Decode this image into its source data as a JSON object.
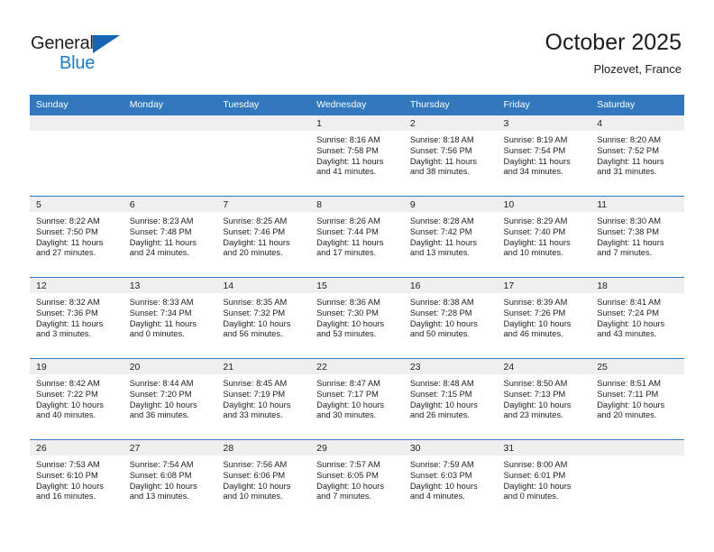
{
  "brand": {
    "name_part1": "General",
    "name_part2": "Blue",
    "triangle_icon": "triangle-icon",
    "colors": {
      "dark": "#231f20",
      "blue": "#1a7cc8",
      "triangle": "#1464b4"
    }
  },
  "header": {
    "title": "October 2025",
    "subtitle": "Plozevet, France"
  },
  "theme": {
    "header_row_bg": "#3179bc",
    "header_row_text": "#ffffff",
    "daynum_band_bg": "#efefef",
    "cell_bg": "#ffffff",
    "row_divider": "#3179bc"
  },
  "weekday_headers": [
    "Sunday",
    "Monday",
    "Tuesday",
    "Wednesday",
    "Thursday",
    "Friday",
    "Saturday"
  ],
  "weeks": [
    [
      {
        "day": "",
        "sunrise": "",
        "sunset": "",
        "daylight_line1": "",
        "daylight_line2": ""
      },
      {
        "day": "",
        "sunrise": "",
        "sunset": "",
        "daylight_line1": "",
        "daylight_line2": ""
      },
      {
        "day": "",
        "sunrise": "",
        "sunset": "",
        "daylight_line1": "",
        "daylight_line2": ""
      },
      {
        "day": "1",
        "sunrise": "Sunrise: 8:16 AM",
        "sunset": "Sunset: 7:58 PM",
        "daylight_line1": "Daylight: 11 hours",
        "daylight_line2": "and 41 minutes."
      },
      {
        "day": "2",
        "sunrise": "Sunrise: 8:18 AM",
        "sunset": "Sunset: 7:56 PM",
        "daylight_line1": "Daylight: 11 hours",
        "daylight_line2": "and 38 minutes."
      },
      {
        "day": "3",
        "sunrise": "Sunrise: 8:19 AM",
        "sunset": "Sunset: 7:54 PM",
        "daylight_line1": "Daylight: 11 hours",
        "daylight_line2": "and 34 minutes."
      },
      {
        "day": "4",
        "sunrise": "Sunrise: 8:20 AM",
        "sunset": "Sunset: 7:52 PM",
        "daylight_line1": "Daylight: 11 hours",
        "daylight_line2": "and 31 minutes."
      }
    ],
    [
      {
        "day": "5",
        "sunrise": "Sunrise: 8:22 AM",
        "sunset": "Sunset: 7:50 PM",
        "daylight_line1": "Daylight: 11 hours",
        "daylight_line2": "and 27 minutes."
      },
      {
        "day": "6",
        "sunrise": "Sunrise: 8:23 AM",
        "sunset": "Sunset: 7:48 PM",
        "daylight_line1": "Daylight: 11 hours",
        "daylight_line2": "and 24 minutes."
      },
      {
        "day": "7",
        "sunrise": "Sunrise: 8:25 AM",
        "sunset": "Sunset: 7:46 PM",
        "daylight_line1": "Daylight: 11 hours",
        "daylight_line2": "and 20 minutes."
      },
      {
        "day": "8",
        "sunrise": "Sunrise: 8:26 AM",
        "sunset": "Sunset: 7:44 PM",
        "daylight_line1": "Daylight: 11 hours",
        "daylight_line2": "and 17 minutes."
      },
      {
        "day": "9",
        "sunrise": "Sunrise: 8:28 AM",
        "sunset": "Sunset: 7:42 PM",
        "daylight_line1": "Daylight: 11 hours",
        "daylight_line2": "and 13 minutes."
      },
      {
        "day": "10",
        "sunrise": "Sunrise: 8:29 AM",
        "sunset": "Sunset: 7:40 PM",
        "daylight_line1": "Daylight: 11 hours",
        "daylight_line2": "and 10 minutes."
      },
      {
        "day": "11",
        "sunrise": "Sunrise: 8:30 AM",
        "sunset": "Sunset: 7:38 PM",
        "daylight_line1": "Daylight: 11 hours",
        "daylight_line2": "and 7 minutes."
      }
    ],
    [
      {
        "day": "12",
        "sunrise": "Sunrise: 8:32 AM",
        "sunset": "Sunset: 7:36 PM",
        "daylight_line1": "Daylight: 11 hours",
        "daylight_line2": "and 3 minutes."
      },
      {
        "day": "13",
        "sunrise": "Sunrise: 8:33 AM",
        "sunset": "Sunset: 7:34 PM",
        "daylight_line1": "Daylight: 11 hours",
        "daylight_line2": "and 0 minutes."
      },
      {
        "day": "14",
        "sunrise": "Sunrise: 8:35 AM",
        "sunset": "Sunset: 7:32 PM",
        "daylight_line1": "Daylight: 10 hours",
        "daylight_line2": "and 56 minutes."
      },
      {
        "day": "15",
        "sunrise": "Sunrise: 8:36 AM",
        "sunset": "Sunset: 7:30 PM",
        "daylight_line1": "Daylight: 10 hours",
        "daylight_line2": "and 53 minutes."
      },
      {
        "day": "16",
        "sunrise": "Sunrise: 8:38 AM",
        "sunset": "Sunset: 7:28 PM",
        "daylight_line1": "Daylight: 10 hours",
        "daylight_line2": "and 50 minutes."
      },
      {
        "day": "17",
        "sunrise": "Sunrise: 8:39 AM",
        "sunset": "Sunset: 7:26 PM",
        "daylight_line1": "Daylight: 10 hours",
        "daylight_line2": "and 46 minutes."
      },
      {
        "day": "18",
        "sunrise": "Sunrise: 8:41 AM",
        "sunset": "Sunset: 7:24 PM",
        "daylight_line1": "Daylight: 10 hours",
        "daylight_line2": "and 43 minutes."
      }
    ],
    [
      {
        "day": "19",
        "sunrise": "Sunrise: 8:42 AM",
        "sunset": "Sunset: 7:22 PM",
        "daylight_line1": "Daylight: 10 hours",
        "daylight_line2": "and 40 minutes."
      },
      {
        "day": "20",
        "sunrise": "Sunrise: 8:44 AM",
        "sunset": "Sunset: 7:20 PM",
        "daylight_line1": "Daylight: 10 hours",
        "daylight_line2": "and 36 minutes."
      },
      {
        "day": "21",
        "sunrise": "Sunrise: 8:45 AM",
        "sunset": "Sunset: 7:19 PM",
        "daylight_line1": "Daylight: 10 hours",
        "daylight_line2": "and 33 minutes."
      },
      {
        "day": "22",
        "sunrise": "Sunrise: 8:47 AM",
        "sunset": "Sunset: 7:17 PM",
        "daylight_line1": "Daylight: 10 hours",
        "daylight_line2": "and 30 minutes."
      },
      {
        "day": "23",
        "sunrise": "Sunrise: 8:48 AM",
        "sunset": "Sunset: 7:15 PM",
        "daylight_line1": "Daylight: 10 hours",
        "daylight_line2": "and 26 minutes."
      },
      {
        "day": "24",
        "sunrise": "Sunrise: 8:50 AM",
        "sunset": "Sunset: 7:13 PM",
        "daylight_line1": "Daylight: 10 hours",
        "daylight_line2": "and 23 minutes."
      },
      {
        "day": "25",
        "sunrise": "Sunrise: 8:51 AM",
        "sunset": "Sunset: 7:11 PM",
        "daylight_line1": "Daylight: 10 hours",
        "daylight_line2": "and 20 minutes."
      }
    ],
    [
      {
        "day": "26",
        "sunrise": "Sunrise: 7:53 AM",
        "sunset": "Sunset: 6:10 PM",
        "daylight_line1": "Daylight: 10 hours",
        "daylight_line2": "and 16 minutes."
      },
      {
        "day": "27",
        "sunrise": "Sunrise: 7:54 AM",
        "sunset": "Sunset: 6:08 PM",
        "daylight_line1": "Daylight: 10 hours",
        "daylight_line2": "and 13 minutes."
      },
      {
        "day": "28",
        "sunrise": "Sunrise: 7:56 AM",
        "sunset": "Sunset: 6:06 PM",
        "daylight_line1": "Daylight: 10 hours",
        "daylight_line2": "and 10 minutes."
      },
      {
        "day": "29",
        "sunrise": "Sunrise: 7:57 AM",
        "sunset": "Sunset: 6:05 PM",
        "daylight_line1": "Daylight: 10 hours",
        "daylight_line2": "and 7 minutes."
      },
      {
        "day": "30",
        "sunrise": "Sunrise: 7:59 AM",
        "sunset": "Sunset: 6:03 PM",
        "daylight_line1": "Daylight: 10 hours",
        "daylight_line2": "and 4 minutes."
      },
      {
        "day": "31",
        "sunrise": "Sunrise: 8:00 AM",
        "sunset": "Sunset: 6:01 PM",
        "daylight_line1": "Daylight: 10 hours",
        "daylight_line2": "and 0 minutes."
      },
      {
        "day": "",
        "sunrise": "",
        "sunset": "",
        "daylight_line1": "",
        "daylight_line2": ""
      }
    ]
  ]
}
